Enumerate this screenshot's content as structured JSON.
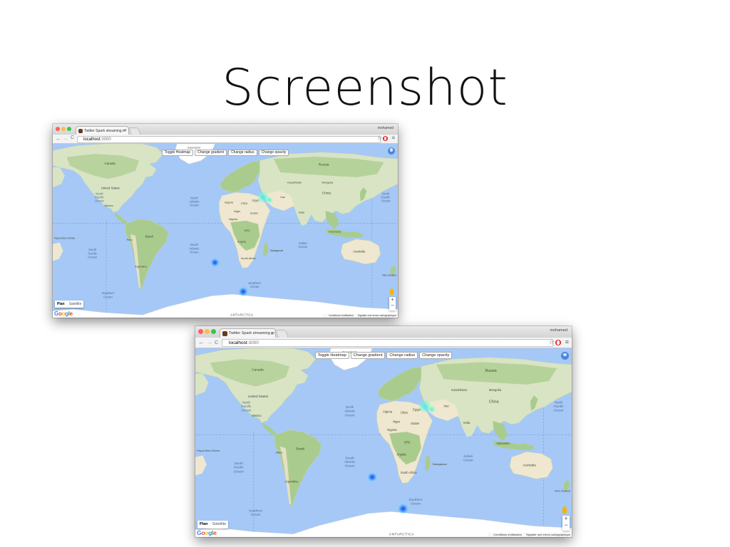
{
  "slide": {
    "title": "Screenshot"
  },
  "window": {
    "tab_title": "Twitter Spark streaming m",
    "tab_close": "×",
    "profile_name": "mohamed",
    "url_host": "localhost",
    "url_port": ":3000",
    "back_label": "←",
    "forward_label": "→",
    "reload_label": "C",
    "star_label": "☆",
    "menu_label": "≡"
  },
  "map": {
    "controls": [
      "Toggle Heatmap",
      "Change gradient",
      "Change radius",
      "Change opacity"
    ],
    "map_type": {
      "plan": "Plan",
      "satellite": "Satellite"
    },
    "attribution": [
      "Conditions d'utilisation",
      "Signaler une erreur cartographique"
    ],
    "zoom_in": "+",
    "zoom_out": "−",
    "logo": [
      "G",
      "o",
      "o",
      "g",
      "l",
      "e"
    ],
    "labels": {
      "greenland": "Greenland",
      "canada": "Canada",
      "united_states": "United States",
      "mexico": "Mexico",
      "brazil": "Brazil",
      "peru": "Peru",
      "argentina": "Argentina",
      "russia": "Russia",
      "kazakhstan": "Kazakhstan",
      "china": "China",
      "mongolia": "Mongolia",
      "india": "India",
      "iran": "Iran",
      "algeria": "Algeria",
      "libya": "Libya",
      "egypt": "Egypt",
      "niger": "Niger",
      "sudan": "Sudan",
      "nigeria": "Nigeria",
      "drc": "DRC",
      "angola": "Angola",
      "south_africa": "South Africa",
      "madagascar": "Madagascar",
      "australia": "Australia",
      "indonesia": "Indonesia",
      "png": "Papua New Guinea",
      "new_zealand": "New Zealand",
      "antarctica": "ANTARCTICA",
      "np_ocean_left": [
        "North",
        "Pacific",
        "Ocean"
      ],
      "na_ocean": [
        "North",
        "Atlantic",
        "Ocean"
      ],
      "np_ocean_right": [
        "North",
        "Pacific",
        "Ocean"
      ],
      "sp_ocean": [
        "South",
        "Pacific",
        "Ocean"
      ],
      "sa_ocean": [
        "South",
        "Atlantic",
        "Ocean"
      ],
      "indian_ocean": [
        "Indian",
        "Ocean"
      ],
      "southern_ocean_left": [
        "Southern",
        "Ocean"
      ],
      "southern_ocean_right": [
        "Southern",
        "Ocean"
      ]
    }
  },
  "colors": {
    "ocean": "#a5c8f7",
    "land": "#d9e4c4",
    "forest": "#a9cc8e",
    "desert": "#efe7cf",
    "ice": "#ffffff",
    "heat_core": "#2e35d6",
    "heat_outer": "#35c7ff"
  }
}
